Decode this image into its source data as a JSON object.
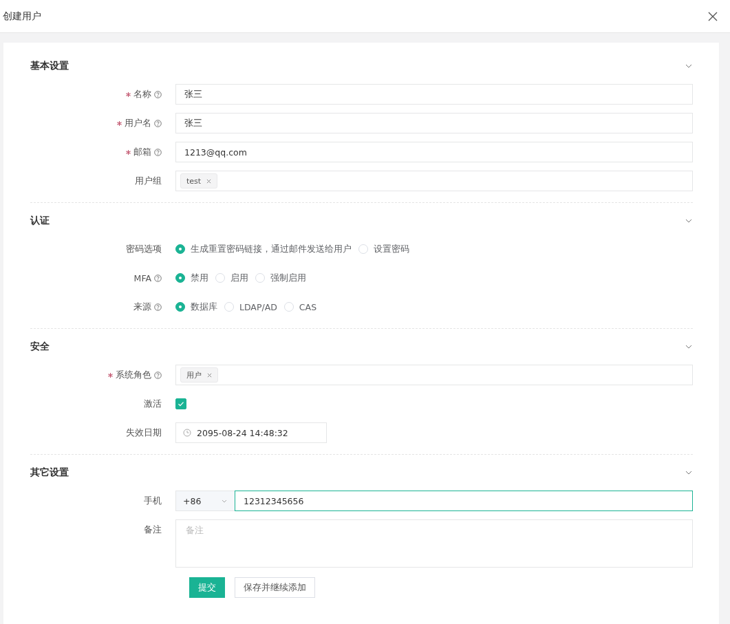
{
  "dialog": {
    "title": "创建用户"
  },
  "sections": [
    {
      "title": "基本设置",
      "expanded": true,
      "fields": [
        {
          "kind": "text",
          "label": "名称",
          "required": true,
          "help": true,
          "value": "张三"
        },
        {
          "kind": "text",
          "label": "用户名",
          "required": true,
          "help": true,
          "value": "张三"
        },
        {
          "kind": "text",
          "label": "邮箱",
          "required": true,
          "help": true,
          "value": "1213@qq.com"
        },
        {
          "kind": "tags",
          "label": "用户组",
          "required": false,
          "help": false,
          "tags": [
            "test"
          ]
        }
      ]
    },
    {
      "title": "认证",
      "expanded": true,
      "fields": [
        {
          "kind": "radio",
          "label": "密码选项",
          "required": false,
          "help": false,
          "options": [
            {
              "label": "生成重置密码链接，通过邮件发送给用户",
              "selected": true
            },
            {
              "label": "设置密码",
              "selected": false
            }
          ]
        },
        {
          "kind": "radio",
          "label": "MFA",
          "required": false,
          "help": true,
          "options": [
            {
              "label": "禁用",
              "selected": true
            },
            {
              "label": "启用",
              "selected": false
            },
            {
              "label": "强制启用",
              "selected": false
            }
          ]
        },
        {
          "kind": "radio",
          "label": "来源",
          "required": false,
          "help": true,
          "options": [
            {
              "label": "数据库",
              "selected": true
            },
            {
              "label": "LDAP/AD",
              "selected": false
            },
            {
              "label": "CAS",
              "selected": false
            }
          ]
        }
      ]
    },
    {
      "title": "安全",
      "expanded": true,
      "fields": [
        {
          "kind": "tags",
          "label": "系统角色",
          "required": true,
          "help": true,
          "tags": [
            "用户"
          ]
        },
        {
          "kind": "checkbox",
          "label": "激活",
          "required": false,
          "help": false,
          "checked": true
        },
        {
          "kind": "date",
          "label": "失效日期",
          "required": false,
          "help": false,
          "value": "2095-08-24 14:48:32"
        }
      ]
    },
    {
      "title": "其它设置",
      "expanded": true,
      "fields": [
        {
          "kind": "phone",
          "label": "手机",
          "required": false,
          "help": false,
          "prefix": "+86",
          "value": "12312345656",
          "focused": true
        },
        {
          "kind": "textarea",
          "label": "备注",
          "required": false,
          "help": false,
          "placeholder": "备注"
        }
      ]
    }
  ],
  "buttons": [
    {
      "label": "提交",
      "primary": true
    },
    {
      "label": "保存并继续添加",
      "primary": false
    }
  ]
}
